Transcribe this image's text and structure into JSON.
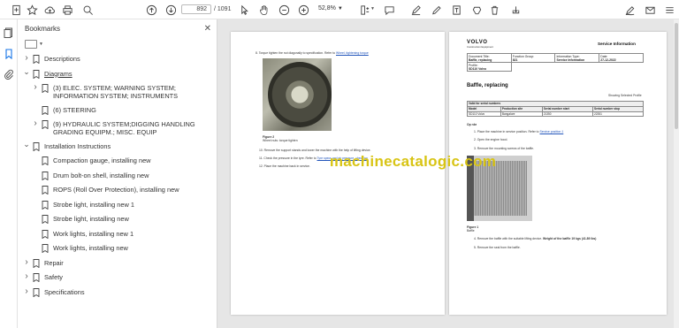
{
  "toolbar": {
    "current_page": "892",
    "total_pages": "/ 1091",
    "zoom": "52,8%"
  },
  "bookmarks": {
    "title": "Bookmarks",
    "items": [
      {
        "label": "Descriptions",
        "level": 0,
        "chevron": ">"
      },
      {
        "label": "Diagrams",
        "level": 0,
        "chevron": "v",
        "underline": true
      },
      {
        "label": "(3) ELEC. SYSTEM; WARNING SYSTEM; INFORMATION SYSTEM; INSTRUMENTS",
        "level": 1,
        "chevron": ">"
      },
      {
        "label": "(6) STEERING",
        "level": 1,
        "chevron": ""
      },
      {
        "label": "(9) HYDRAULIC SYSTEM;DIGGING HANDLING GRADING EQUIPM.; MISC. EQUIP",
        "level": 1,
        "chevron": ">"
      },
      {
        "label": "Installation Instructions",
        "level": 0,
        "chevron": "v"
      },
      {
        "label": "Compaction gauge, installing new",
        "level": 1,
        "chevron": ""
      },
      {
        "label": "Drum bolt-on shell, installing new",
        "level": 1,
        "chevron": ""
      },
      {
        "label": "ROPS (Roll Over Protection), installing new",
        "level": 1,
        "chevron": ""
      },
      {
        "label": "Strobe light, installing new 1",
        "level": 1,
        "chevron": ""
      },
      {
        "label": "Strobe light, installing new",
        "level": 1,
        "chevron": ""
      },
      {
        "label": "Work lights, installing new 1",
        "level": 1,
        "chevron": ""
      },
      {
        "label": "Work lights, installing new",
        "level": 1,
        "chevron": ""
      },
      {
        "label": "Repair",
        "level": 0,
        "chevron": ">"
      },
      {
        "label": "Safety",
        "level": 0,
        "chevron": ">"
      },
      {
        "label": "Specifications",
        "level": 0,
        "chevron": ">"
      }
    ]
  },
  "left_page": {
    "step8": "8.   Torque tighten the nut diagonally to specification. Refer to",
    "step8_link": "Wheel, tightening torque",
    "figure_caption": "Figure 2",
    "figure_sub": "Wheel nuts: torque tighten",
    "step10": "10.   Remove the support stands and lower the machine with the help of lifting device.",
    "step11": "11.   Check the pressure in the tyre. Refer to",
    "step11_link": "Tyre specs and air pressure, checking",
    "step12": "12.   Place the machine back in service."
  },
  "right_page": {
    "brand": "VOLVO",
    "brand_sub": "Construction Equipment",
    "service_info": "Service Information",
    "meta": {
      "doc_title_label": "Document Title:",
      "doc_title": "Baffle, replacing",
      "function_group_label": "Function Group:",
      "function_group": "821",
      "info_type_label": "Information Type:",
      "info_type": "Service Information",
      "date_label": "Date:",
      "date": "27-12-2022",
      "profile_label": "Profile:",
      "profile": "SD110 Volvo"
    },
    "heading": "Baffle, replacing",
    "showing_profile": "Showing Selected Profile",
    "serial_title": "Valid for serial numbers",
    "serial_headers": [
      "Model",
      "Production site",
      "Serial number start",
      "Serial number stop"
    ],
    "serial_row": [
      "SD110 Volvo",
      "Bangalore",
      "21350",
      "22351"
    ],
    "op_label": "Op nbr",
    "step1": "1.   Place the machine in service position. Refer to",
    "step1_link": "Service position 1",
    "step2": "2.   Open the engine hood.",
    "step3": "3.   Remove the mounting screws of the baffle.",
    "figure_caption": "Figure 1",
    "figure_sub": "Baffle",
    "step4": "4.   Remove the baffle with the suitable lifting device.",
    "step4_bold": "Weight of the baffle 19 kgs (41.89 lbs)",
    "step5": "5.   Remove the seal from the baffle."
  },
  "watermark": "machinecatalogic.com"
}
